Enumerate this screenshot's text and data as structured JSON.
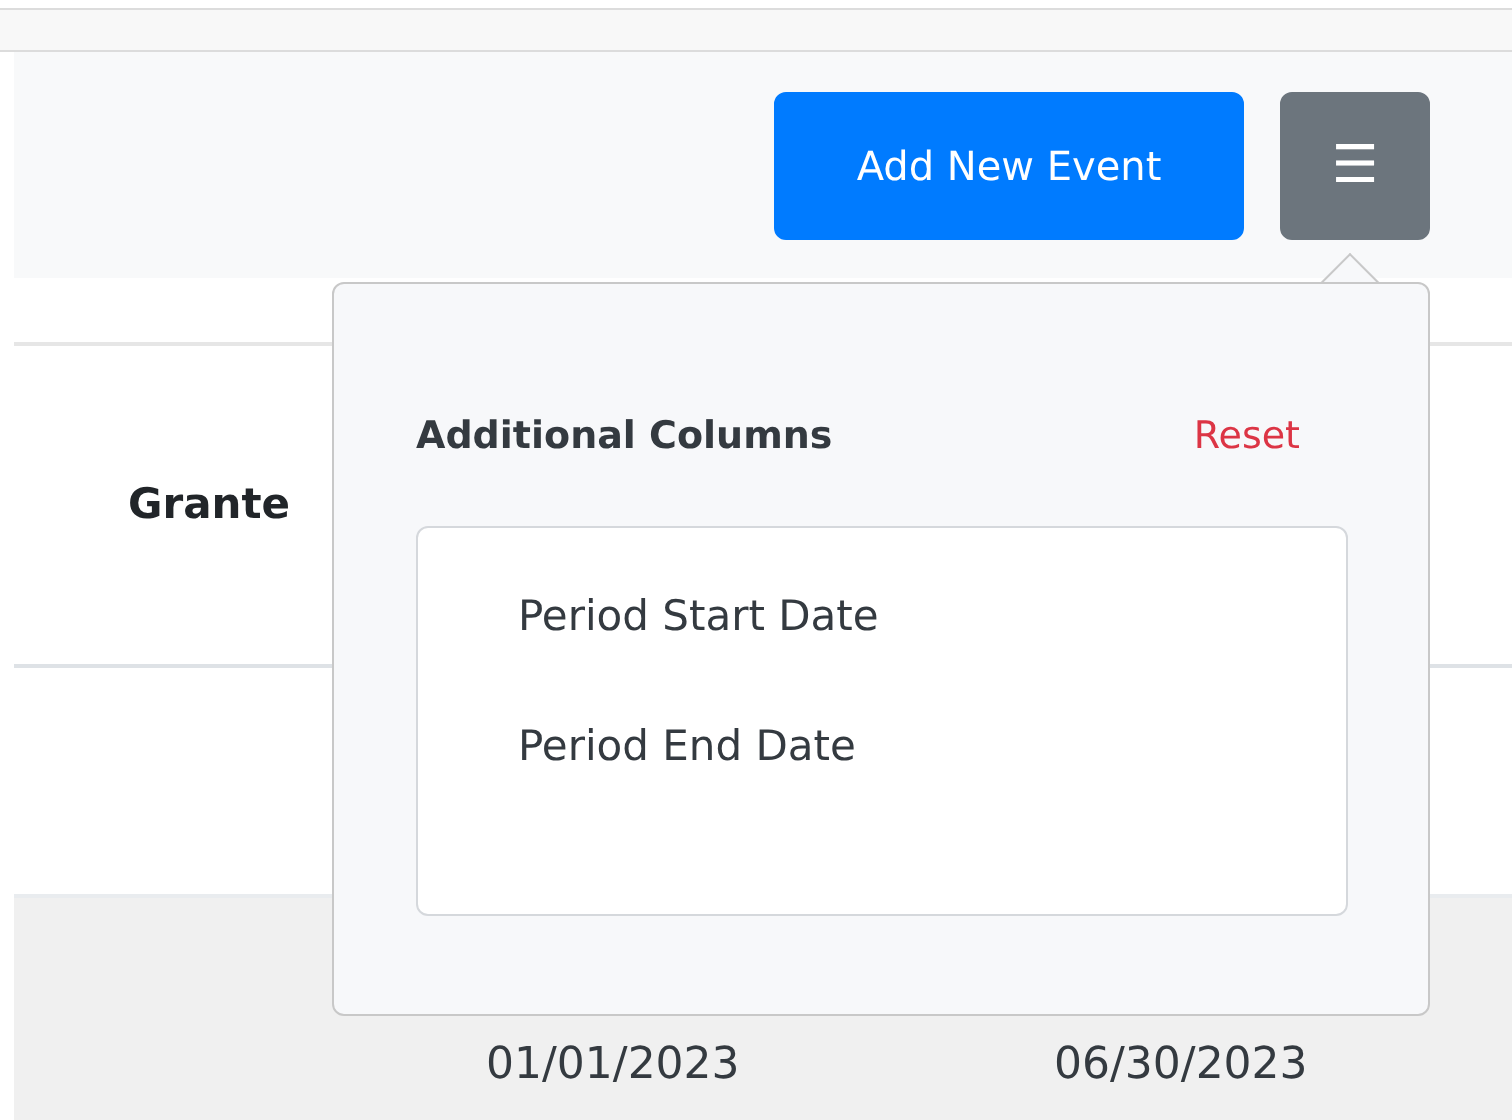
{
  "toolbar": {
    "add_button": "Add New Event",
    "menu_button": "☰"
  },
  "table": {
    "columns": [
      "Grante"
    ],
    "rows": [
      {
        "cells": [
          "01/01/2023",
          "06/30/2023"
        ]
      }
    ]
  },
  "popover": {
    "title": "Additional Columns",
    "reset": "Reset",
    "items": [
      {
        "label": "Period Start Date"
      },
      {
        "label": "Period End Date"
      }
    ]
  }
}
